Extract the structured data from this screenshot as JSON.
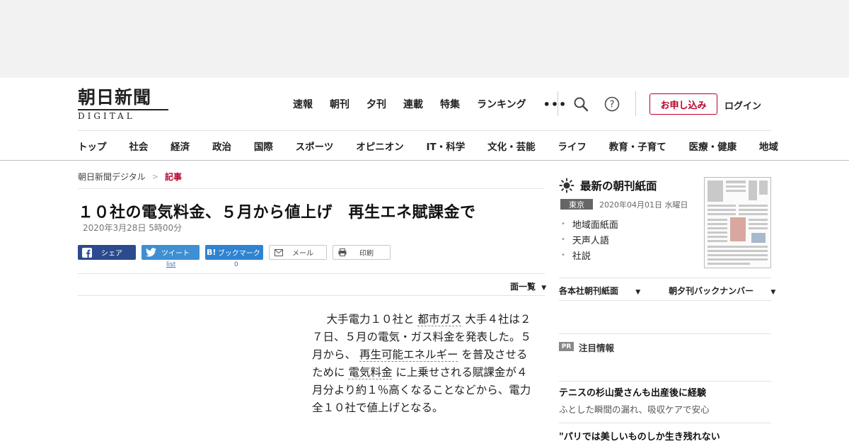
{
  "colors": {
    "accent": "#b8002c",
    "facebook": "#2c4a8e",
    "twitter": "#3e8fd3",
    "hatena": "#2f83d2",
    "link": "#3a6fb7"
  },
  "header": {
    "logo_main": "朝日新聞",
    "logo_sub": "DIGITAL",
    "nav": [
      "速報",
      "朝刊",
      "夕刊",
      "連載",
      "特集",
      "ランキング"
    ],
    "more": "•••",
    "apply": "お申し込み",
    "login": "ログイン",
    "icons": [
      "search-icon",
      "help-icon"
    ]
  },
  "categories": [
    "トップ",
    "社会",
    "経済",
    "政治",
    "国際",
    "スポーツ",
    "オピニオン",
    "IT・科学",
    "文化・芸能",
    "ライフ",
    "教育・子育て",
    "医療・健康",
    "地域"
  ],
  "breadcrumb": {
    "home": "朝日新聞デジタル",
    "sep": ">",
    "current": "記事"
  },
  "article": {
    "headline": "１０社の電気料金、５月から値上げ　再生エネ賦課金で",
    "date": "2020年3月28日 5時00分",
    "page_list": "面一覧",
    "body": [
      {
        "t": "大手電力１０社と "
      },
      {
        "t": "都市ガス",
        "link": true
      },
      {
        "t": " 大手４社は２７日、５月の電気・ガス料金を発表した。５月から、 "
      },
      {
        "t": "再生可能エネルギー",
        "link": true
      },
      {
        "t": " を普及させるために "
      },
      {
        "t": "電気料金",
        "link": true
      },
      {
        "t": " に上乗せされる賦課金が４月分より約１％高くなることなどから、電力全１０社で値上げとなる。"
      }
    ]
  },
  "share": {
    "facebook": "シェア",
    "twitter": "ツイート",
    "twitter_count": "list",
    "hatena": "ブックマーク",
    "hatena_icon": "B!",
    "hatena_count": "0",
    "mail": "メール",
    "print": "印刷"
  },
  "sidebar": {
    "paper_title": "最新の朝刊紙面",
    "region": "東京",
    "paper_date": "2020年04月01日 水曜日",
    "links": [
      "地域面紙面",
      "天声人語",
      "社説"
    ],
    "menu1": "各本社朝刊紙面",
    "menu2": "朝夕刊バックナンバー",
    "pr_badge": "PR",
    "pr_title": "注目情報",
    "promo1_title": "テニスの杉山愛さんも出産後に経験",
    "promo1_sub": "ふとした瞬間の漏れ、吸収ケアで安心",
    "promo2_title": "\"パリでは美しいものしか生き残れない"
  }
}
